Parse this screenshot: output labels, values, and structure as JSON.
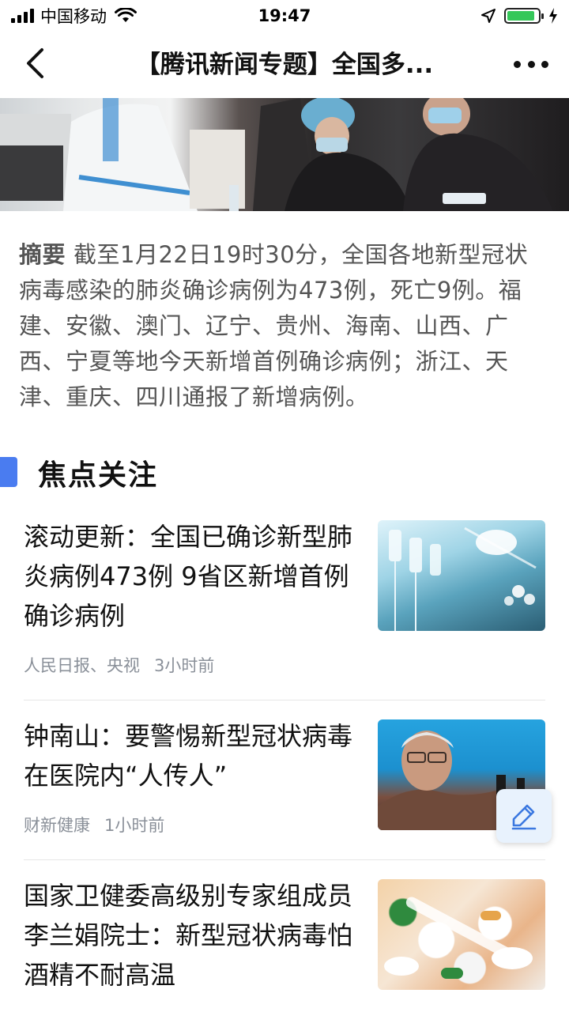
{
  "status_bar": {
    "carrier": "中国移动",
    "time": "19:47",
    "battery_level": 0.9
  },
  "nav": {
    "title": "【腾讯新闻专题】全国多..."
  },
  "summary": {
    "tag": "摘要",
    "text": "截至1月22日19时30分，全国各地新型冠状病毒感染的肺炎确诊病例为473例，死亡9例。福建、安徽、澳门、辽宁、贵州、海南、山西、广西、宁夏等地今天新增首例确诊病例；浙江、天津、重庆、四川通报了新增病例。"
  },
  "section": {
    "title": "焦点关注",
    "accent_color": "#4a7cf0"
  },
  "news": [
    {
      "title": "滚动更新：全国已确诊新型肺炎病例473例 9省区新增首例确诊病例",
      "source": "人民日报、央视",
      "time_ago": "3小时前"
    },
    {
      "title": "钟南山：要警惕新型冠状病毒在医院内“人传人”",
      "source": "财新健康",
      "time_ago": "1小时前"
    },
    {
      "title": "国家卫健委高级别专家组成员李兰娟院士：新型冠状病毒怕酒精不耐高温",
      "source": "",
      "time_ago": ""
    }
  ],
  "icons": {
    "back": "chevron-left-icon",
    "more": "more-dots-icon",
    "edit": "pencil-icon"
  }
}
